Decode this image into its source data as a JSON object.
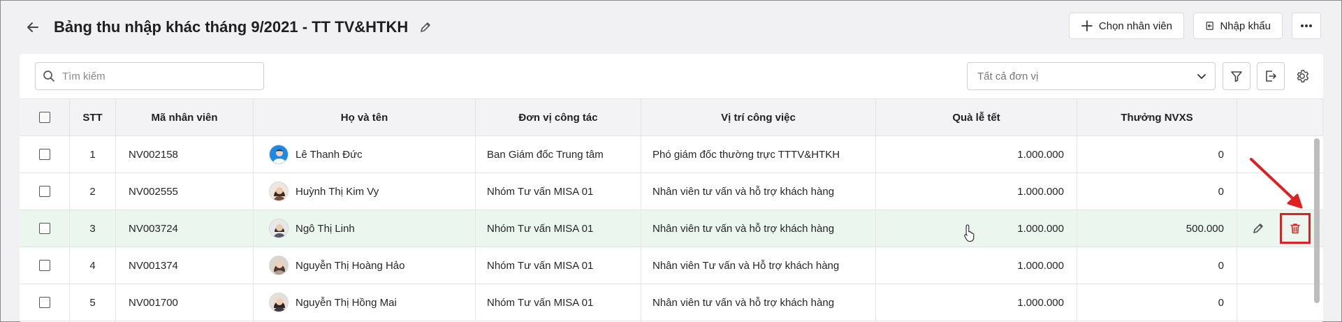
{
  "header": {
    "title": "Bảng thu nhập khác tháng 9/2021 - TT TV&HTKH",
    "choose_label": "Chọn nhân viên",
    "import_label": "Nhập khẩu"
  },
  "toolbar": {
    "search_placeholder": "Tìm kiếm",
    "unit_select_value": "Tất cả đơn vị"
  },
  "columns": [
    "STT",
    "Mã nhân viên",
    "Họ và tên",
    "Đơn vị công tác",
    "Vị trí công việc",
    "Quà lễ tết",
    "Thưởng NVXS"
  ],
  "rows": [
    {
      "stt": "1",
      "code": "NV002158",
      "name": "Lê Thanh Đức",
      "unit": "Ban Giám đốc Trung tâm",
      "position": "Phó giám đốc thường trực TTTV&HTKH",
      "gift": "1.000.000",
      "bonus": "0"
    },
    {
      "stt": "2",
      "code": "NV002555",
      "name": "Huỳnh Thị Kim Vy",
      "unit": "Nhóm Tư vấn MISA 01",
      "position": "Nhân viên tư vấn và hỗ trợ khách hàng",
      "gift": "1.000.000",
      "bonus": "0"
    },
    {
      "stt": "3",
      "code": "NV003724",
      "name": "Ngô Thị Linh",
      "unit": "Nhóm Tư vấn MISA 01",
      "position": "Nhân viên tư vấn và hỗ trợ khách hàng",
      "gift": "1.000.000",
      "bonus": "500.000"
    },
    {
      "stt": "4",
      "code": "NV001374",
      "name": "Nguyễn Thị Hoàng Hảo",
      "unit": "Nhóm Tư vấn MISA 01",
      "position": "Nhân viên Tư vấn và Hỗ trợ khách hàng",
      "gift": "1.000.000",
      "bonus": "0"
    },
    {
      "stt": "5",
      "code": "NV001700",
      "name": "Nguyễn Thị Hồng Mai",
      "unit": "Nhóm Tư vấn MISA 01",
      "position": "Nhân viên tư vấn và hỗ trợ khách hàng",
      "gift": "1.000.000",
      "bonus": "0"
    }
  ],
  "colors": {
    "accent_delete": "#e02020",
    "selected_row": "#eaf6ee",
    "header_bg": "#f3f3f5"
  },
  "icons": [
    "back-arrow-icon",
    "pencil-icon",
    "plus-icon",
    "import-icon",
    "more-icon",
    "search-icon",
    "chevron-down-icon",
    "filter-icon",
    "export-icon",
    "gear-icon",
    "trash-icon"
  ]
}
